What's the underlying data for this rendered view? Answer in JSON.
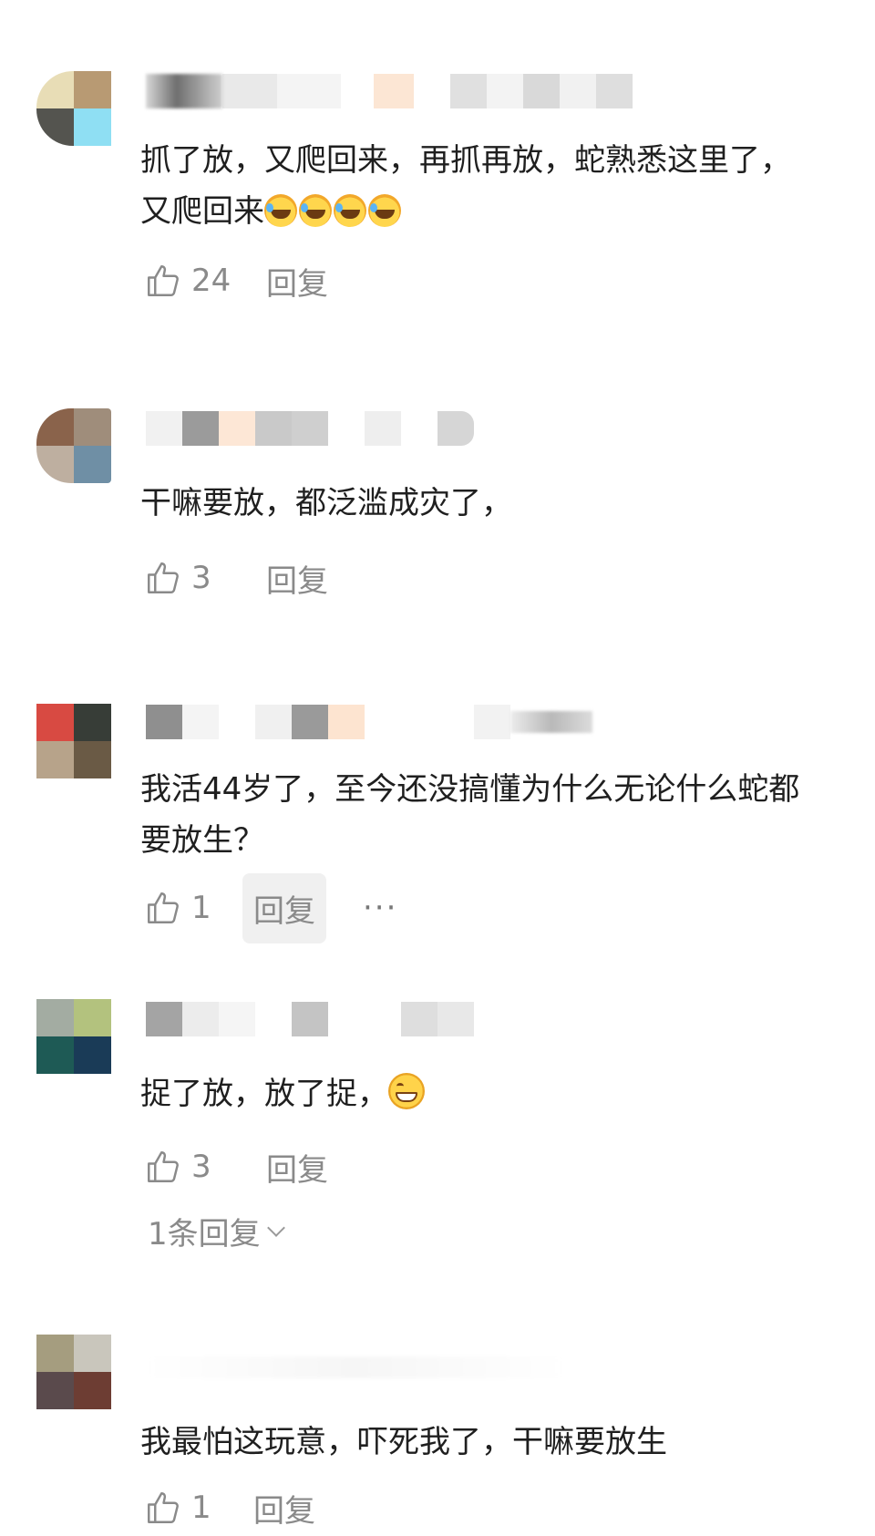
{
  "comments": [
    {
      "text_parts": [
        "抓了放，又爬回来，再抓再放，蛇熟悉这里了，又爬回来"
      ],
      "emojis": [
        "laugh-cry-emoji",
        "laugh-cry-emoji",
        "laugh-cry-emoji",
        "laugh-cry-emoji"
      ],
      "likes": "24",
      "reply_label": "回复"
    },
    {
      "text_parts": [
        "干嘛要放，都泛滥成灾了，"
      ],
      "likes": "3",
      "reply_label": "回复"
    },
    {
      "text_parts": [
        "我活44岁了，至今还没搞懂为什么无论什么蛇都要放生？"
      ],
      "likes": "1",
      "reply_label": "回复",
      "more_label": "···"
    },
    {
      "text_parts": [
        "捉了放，放了捉，"
      ],
      "emojis": [
        "grin-emoji"
      ],
      "likes": "3",
      "reply_label": "回复",
      "thread_toggle": "1条回复"
    },
    {
      "text_parts": [
        "我最怕这玩意，吓死我了，干嘛要放生"
      ],
      "likes": "1",
      "reply_label": "回复"
    }
  ],
  "colors": {
    "text": "#1f1f1f",
    "meta": "#8a8a8a",
    "reply_hover_bg": "#f0f0f0"
  },
  "icons": {
    "like": "thumbs-up-outline-icon",
    "chevron": "chevron-down-icon"
  }
}
